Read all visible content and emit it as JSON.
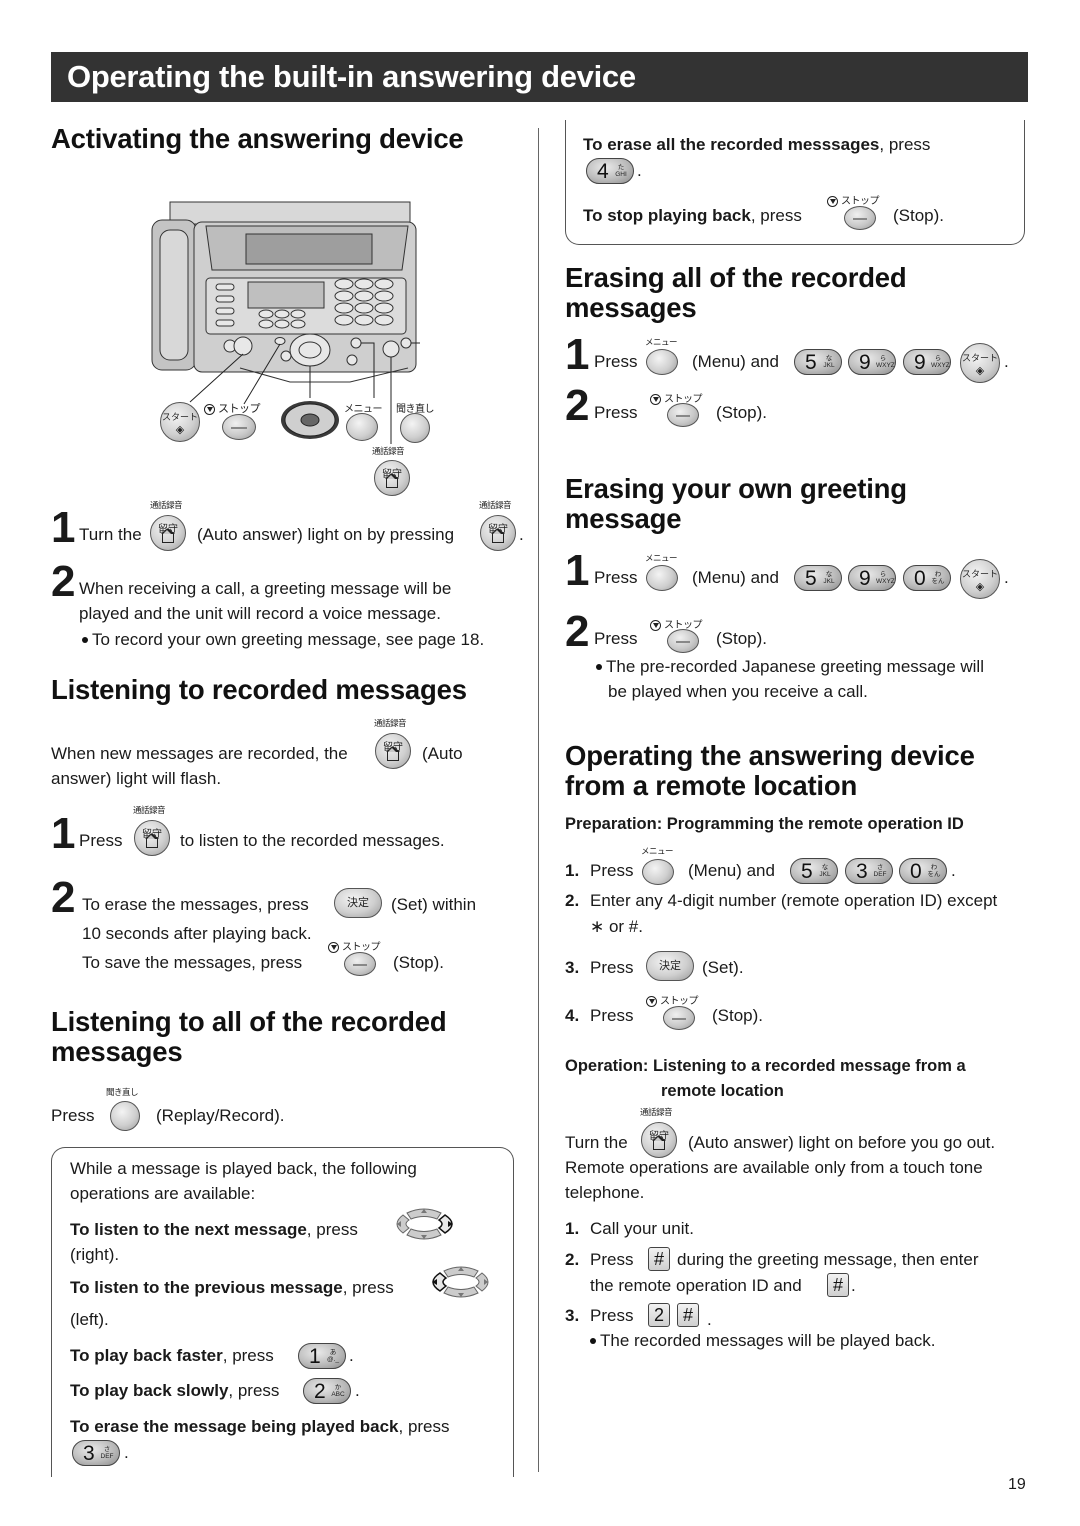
{
  "page_title": "Operating the built-in answering device",
  "page_number": "19",
  "key_labels": {
    "auto_answer_top": "通話録音",
    "auto_answer_face": "留守",
    "stop_top": "ストップ",
    "menu_top": "メニュー",
    "replay_top": "聞き直し",
    "start_face": "スタート",
    "start_symbol": "◈",
    "set_face": "決定"
  },
  "left": {
    "activating": {
      "heading": "Activating the answering device",
      "diagram_labels": {
        "start": "スタート",
        "stop": "ストップ",
        "menu": "メニュー",
        "replay": "聞き直し",
        "record": "通話録音",
        "auto": "留守"
      },
      "step1_num": "1",
      "step1_a": "Turn the",
      "step1_b": "(Auto answer) light on by pressing",
      "step1_c": ".",
      "step2_num": "2",
      "step2_line1": "When receiving a call, a greeting message will be",
      "step2_line2": "played and the unit will record a voice message.",
      "step2_bullet": "To record your own greeting message, see page 18."
    },
    "listening": {
      "heading": "Listening to recorded messages",
      "intro_a": "When new messages are recorded, the",
      "intro_b": "(Auto",
      "intro_c": "answer) light will flash.",
      "step1_num": "1",
      "step1_a": "Press",
      "step1_b": "to listen to the recorded messages.",
      "step2_num": "2",
      "step2_a": "To erase the messages, press",
      "step2_b": "(Set) within",
      "step2_c": "10 seconds after playing back.",
      "step2_d": "To save the messages, press",
      "step2_e": "(Stop)."
    },
    "listening_all": {
      "heading_line1": "Listening to all of the recorded",
      "heading_line2": "messages",
      "press": "Press",
      "replay": "(Replay/Record).",
      "box_intro1": "While a message is played back, the following",
      "box_intro2": "operations are available:",
      "next_bold": "To listen to the next message",
      "next_rest": ", press",
      "next_dir": "(right).",
      "prev_bold": "To listen to the previous message",
      "prev_rest": ", press",
      "prev_dir": "(left).",
      "faster_bold": "To play back faster",
      "faster_rest": ", press",
      "slower_bold": "To play back slowly",
      "slower_rest": ", press",
      "erase_bold": "To erase the message being played back",
      "erase_rest": ", press",
      "period": "."
    }
  },
  "right": {
    "box_cont": {
      "erase_all_bold": "To erase all the recorded messsages",
      "erase_all_rest": ", press",
      "stop_bold": "To stop playing back",
      "stop_rest": ", press",
      "stop_label": "(Stop).",
      "period": "."
    },
    "erase_all": {
      "heading_line1": "Erasing all of the recorded",
      "heading_line2": "messages",
      "step1_num": "1",
      "step1_press": "Press",
      "step1_menu": "(Menu) and",
      "step2_num": "2",
      "step2_press": "Press",
      "step2_stop": "(Stop).",
      "period": "."
    },
    "erase_greeting": {
      "heading_line1": "Erasing your own greeting",
      "heading_line2": "message",
      "step1_num": "1",
      "step1_press": "Press",
      "step1_menu": "(Menu) and",
      "step2_num": "2",
      "step2_press": "Press",
      "step2_stop": "(Stop).",
      "bullet_line1": "The pre-recorded Japanese greeting message will",
      "bullet_line2": "be played when you receive a call.",
      "period": "."
    },
    "remote": {
      "heading_line1": "Operating the answering device",
      "heading_line2": "from a remote location",
      "prep_heading": "Preparation: Programming the remote operation ID",
      "prep_steps": [
        {
          "num": "1.",
          "press": "Press",
          "menu": "(Menu) and",
          "end": "."
        },
        {
          "num": "2.",
          "line1": "Enter any 4-digit number (remote operation ID) except",
          "line2": "∗ or #."
        },
        {
          "num": "3.",
          "press": "Press",
          "set": "(Set)."
        },
        {
          "num": "4.",
          "press": "Press",
          "stop": "(Stop)."
        }
      ],
      "op_heading_a": "Operation: Listening to a recorded message from a",
      "op_heading_b": "remote location",
      "op_intro_a": "Turn the",
      "op_intro_b": "(Auto answer) light on before you go out.",
      "op_intro_c": "Remote operations are available only from a touch tone",
      "op_intro_d": "telephone.",
      "op_steps": [
        {
          "num": "1.",
          "text": "Call your unit."
        },
        {
          "num": "2.",
          "press": "Press",
          "rest": "during the greeting message, then enter",
          "line2": "the remote operation ID and",
          "end": "."
        },
        {
          "num": "3.",
          "press": "Press",
          "end": "."
        }
      ],
      "op_bullet": "The recorded messages will be played back.",
      "hash_key": "#",
      "two_key": "2"
    }
  },
  "numkeys": {
    "k0": {
      "digit": "0",
      "sub": "わ\nをん"
    },
    "k1": {
      "digit": "1",
      "sub": "あ\n@._"
    },
    "k2": {
      "digit": "2",
      "sub": "か\nABC"
    },
    "k3": {
      "digit": "3",
      "sub": "さ\nDEF"
    },
    "k4": {
      "digit": "4",
      "sub": "た\nGHI"
    },
    "k5": {
      "digit": "5",
      "sub": "な\nJKL"
    },
    "k9": {
      "digit": "9",
      "sub": "ら\nWXYZ"
    }
  }
}
